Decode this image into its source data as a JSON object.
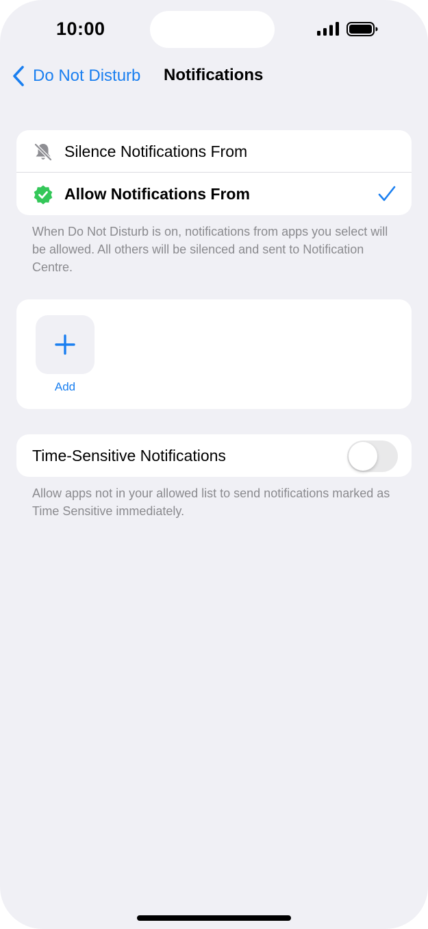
{
  "status_bar": {
    "time": "10:00"
  },
  "nav": {
    "back_label": "Do Not Disturb",
    "title": "Notifications"
  },
  "mode_group": {
    "rows": [
      {
        "label": "Silence Notifications From",
        "icon": "bell-slash-icon",
        "selected": false
      },
      {
        "label": "Allow Notifications From",
        "icon": "checkmark-seal-icon",
        "selected": true
      }
    ],
    "footnote": "When Do Not Disturb is on, notifications from apps you select will be allowed. All others will be silenced and sent to Notification Centre."
  },
  "apps_group": {
    "add_label": "Add"
  },
  "time_sensitive": {
    "label": "Time-Sensitive Notifications",
    "enabled": false,
    "footnote": "Allow apps not in your allowed list to send notifications marked as Time Sensitive immediately."
  },
  "colors": {
    "accent": "#1a7ff0",
    "seal_green": "#34c759",
    "background": "#f0f0f5",
    "secondary_text": "#8a8a8e"
  }
}
